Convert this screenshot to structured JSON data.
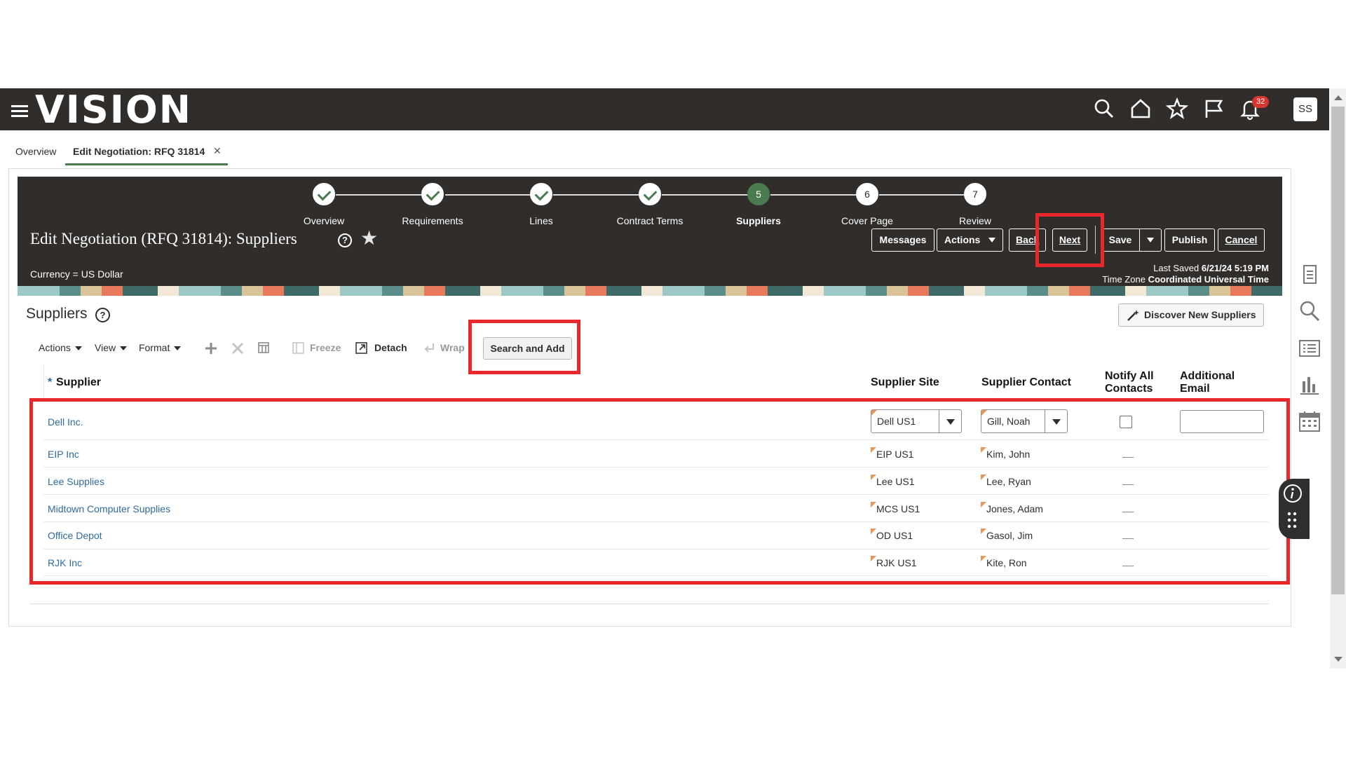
{
  "app": {
    "logo_text": "VISION"
  },
  "topbar": {
    "icons": [
      "menu-icon",
      "search-icon",
      "home-icon",
      "star-icon",
      "flag-icon",
      "bell-icon"
    ],
    "notification_count": "32",
    "avatar_initials": "SS"
  },
  "tabs": [
    {
      "label": "Overview"
    },
    {
      "label": "Edit Negotiation: RFQ 31814"
    }
  ],
  "train": {
    "steps": [
      {
        "label": "Overview",
        "status": "done",
        "number": ""
      },
      {
        "label": "Requirements",
        "status": "done",
        "number": ""
      },
      {
        "label": "Lines",
        "status": "done",
        "number": ""
      },
      {
        "label": "Contract Terms",
        "status": "done",
        "number": ""
      },
      {
        "label": "Suppliers",
        "status": "current",
        "number": "5"
      },
      {
        "label": "Cover Page",
        "status": "todo",
        "number": "6"
      },
      {
        "label": "Review",
        "status": "todo",
        "number": "7"
      }
    ]
  },
  "header": {
    "title": "Edit Negotiation (RFQ 31814): Suppliers",
    "currency": "Currency = US Dollar",
    "last_saved_label": "Last Saved",
    "last_saved_value": "6/21/24 5:19 PM",
    "timezone_label": "Time Zone",
    "timezone_value": "Coordinated Universal Time",
    "buttons": {
      "messages": "Messages",
      "actions": "Actions",
      "back": "Back",
      "next": "Next",
      "save": "Save",
      "publish": "Publish",
      "cancel": "Cancel"
    }
  },
  "suppliers_section": {
    "title": "Suppliers",
    "discover_button": "Discover New Suppliers",
    "toolbar": {
      "actions": "Actions",
      "view": "View",
      "format": "Format",
      "freeze": "Freeze",
      "detach": "Detach",
      "wrap": "Wrap",
      "search_and_add": "Search and Add"
    },
    "columns": {
      "required_marker": "*",
      "supplier": "Supplier",
      "supplier_site": "Supplier Site",
      "supplier_contact": "Supplier Contact",
      "notify_all_line1": "Notify All",
      "notify_all_line2": "Contacts",
      "additional_email_line1": "Additional",
      "additional_email_line2": "Email"
    },
    "rows": [
      {
        "supplier": "Dell Inc.",
        "site": "Dell US1",
        "contact": "Gill, Noah",
        "editable": true
      },
      {
        "supplier": "EIP Inc",
        "site": "EIP US1",
        "contact": "Kim, John"
      },
      {
        "supplier": "Lee Supplies",
        "site": "Lee US1",
        "contact": "Lee, Ryan"
      },
      {
        "supplier": "Midtown Computer Supplies",
        "site": "MCS US1",
        "contact": "Jones, Adam"
      },
      {
        "supplier": "Office Depot",
        "site": "OD US1",
        "contact": "Gasol, Jim"
      },
      {
        "supplier": "RJK Inc",
        "site": "RJK US1",
        "contact": "Kite, Ron"
      }
    ]
  },
  "colors": {
    "header_bg": "#312d2a",
    "accent_green": "#4a7b4f",
    "link_blue": "#2e6b9e",
    "highlight_red": "#e8282b"
  }
}
